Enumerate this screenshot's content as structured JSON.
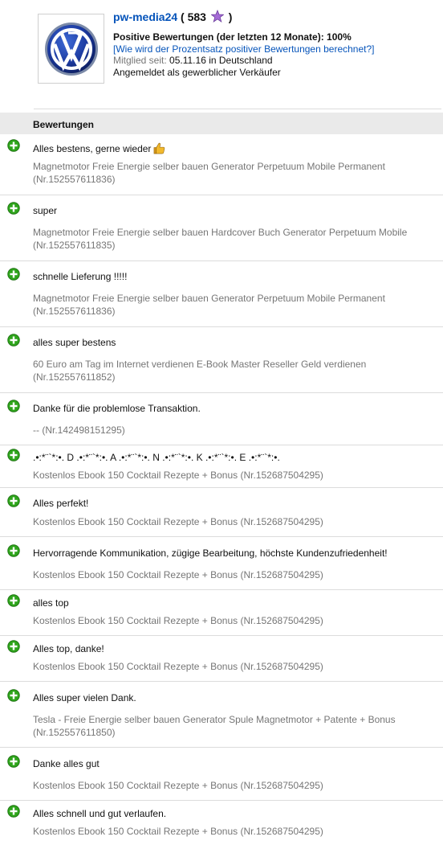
{
  "seller": {
    "name": "pw-media24",
    "score_open": "(",
    "score": "583",
    "score_close": ")",
    "positive_line": "Positive Bewertungen (der letzten 12 Monate): 100%",
    "calc_link": "[Wie wird der Prozentsatz positiver Bewertungen berechnet?]",
    "member_label": "Mitglied seit:",
    "member_since": "05.11.16 in Deutschland",
    "seller_type": "Angemeldet als gewerblicher Verkäufer",
    "star_color": "#a56bd6"
  },
  "section_title": "Bewertungen",
  "colors": {
    "plus_green": "#2ea41b",
    "link_blue": "#0654ba",
    "thumb_yellow": "#f2b92c"
  },
  "feedback": [
    {
      "comment": "Alles bestens, gerne wieder",
      "thumb": true,
      "item": "Magnetmotor Freie Energie selber bauen Generator Perpetuum Mobile Permanent (Nr.152557611836)"
    },
    {
      "comment": "super",
      "item": "Magnetmotor Freie Energie selber bauen Hardcover Buch Generator Perpetuum Mobile (Nr.152557611835)"
    },
    {
      "comment": "schnelle Lieferung !!!!!",
      "item": "Magnetmotor Freie Energie selber bauen Generator Perpetuum Mobile Permanent (Nr.152557611836)"
    },
    {
      "comment": "alles super bestens",
      "item": "60 Euro am Tag im Internet verdienen E-Book Master Reseller Geld verdienen (Nr.152557611852)"
    },
    {
      "comment": "Danke für die problemlose Transaktion.",
      "item": "-- (Nr.142498151295)"
    },
    {
      "comment": ".•:*¨`*:•. D .•:*¨`*:•. A .•:*¨`*:•. N .•:*¨`*:•. K .•:*¨`*:•. E .•:*¨`*:•.",
      "item": "Kostenlos Ebook 150 Cocktail Rezepte + Bonus (Nr.152687504295)"
    },
    {
      "comment": "Alles perfekt!",
      "item": "Kostenlos Ebook 150 Cocktail Rezepte + Bonus (Nr.152687504295)"
    },
    {
      "comment": "Hervorragende Kommunikation, zügige Bearbeitung, höchste Kundenzufriedenheit!",
      "item": "Kostenlos Ebook 150 Cocktail Rezepte + Bonus (Nr.152687504295)"
    },
    {
      "comment": "alles top",
      "item": "Kostenlos Ebook 150 Cocktail Rezepte + Bonus (Nr.152687504295)"
    },
    {
      "comment": "Alles top, danke!",
      "item": "Kostenlos Ebook 150 Cocktail Rezepte + Bonus (Nr.152687504295)"
    },
    {
      "comment": "Alles super vielen Dank.",
      "item": "Tesla - Freie Energie selber bauen Generator Spule Magnetmotor + Patente + Bonus (Nr.152557611850)"
    },
    {
      "comment": "Danke alles gut",
      "item": "Kostenlos Ebook 150 Cocktail Rezepte + Bonus (Nr.152687504295)"
    },
    {
      "comment": "Alles schnell und gut verlaufen.",
      "item": "Kostenlos Ebook 150 Cocktail Rezepte + Bonus (Nr.152687504295)"
    }
  ]
}
